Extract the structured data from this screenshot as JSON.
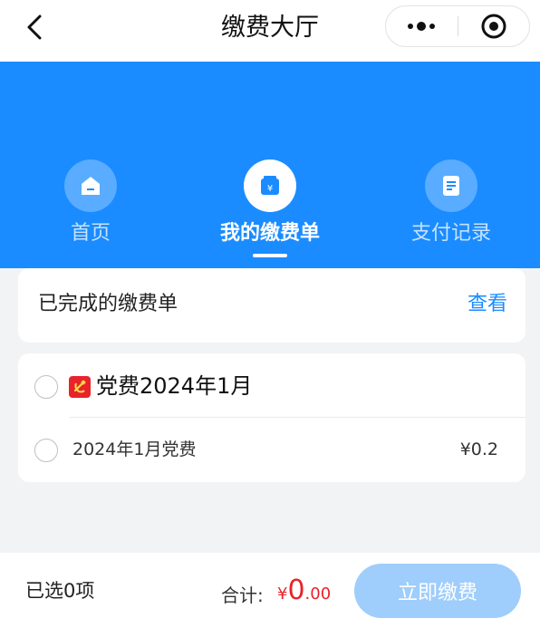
{
  "navbar": {
    "title": "缴费大厅",
    "back_icon": "chevron-left-icon",
    "more_icon": "more-dots-icon",
    "close_icon": "target-close-icon"
  },
  "colors": {
    "primary": "#1a8cff",
    "danger": "#e8232a",
    "background": "#f2f3f5",
    "pay_button_disabled": "#9fcdfc"
  },
  "tabs": [
    {
      "label": "首页",
      "icon": "home-icon",
      "active": false
    },
    {
      "label": "我的缴费单",
      "icon": "bill-icon",
      "active": true
    },
    {
      "label": "支付记录",
      "icon": "document-icon",
      "active": false
    }
  ],
  "completed": {
    "title": "已完成的缴费单",
    "action": "查看"
  },
  "bill_group": {
    "badge_icon": "party-emblem-icon",
    "title": "党费2024年1月",
    "items": [
      {
        "name": "2024年1月党费",
        "amount": "¥0.2"
      }
    ]
  },
  "footer": {
    "selected_text": "已选0项",
    "total_label": "合计:",
    "currency": "¥",
    "amount_int": "0",
    "amount_dec": ".00",
    "pay_label": "立即缴费"
  }
}
